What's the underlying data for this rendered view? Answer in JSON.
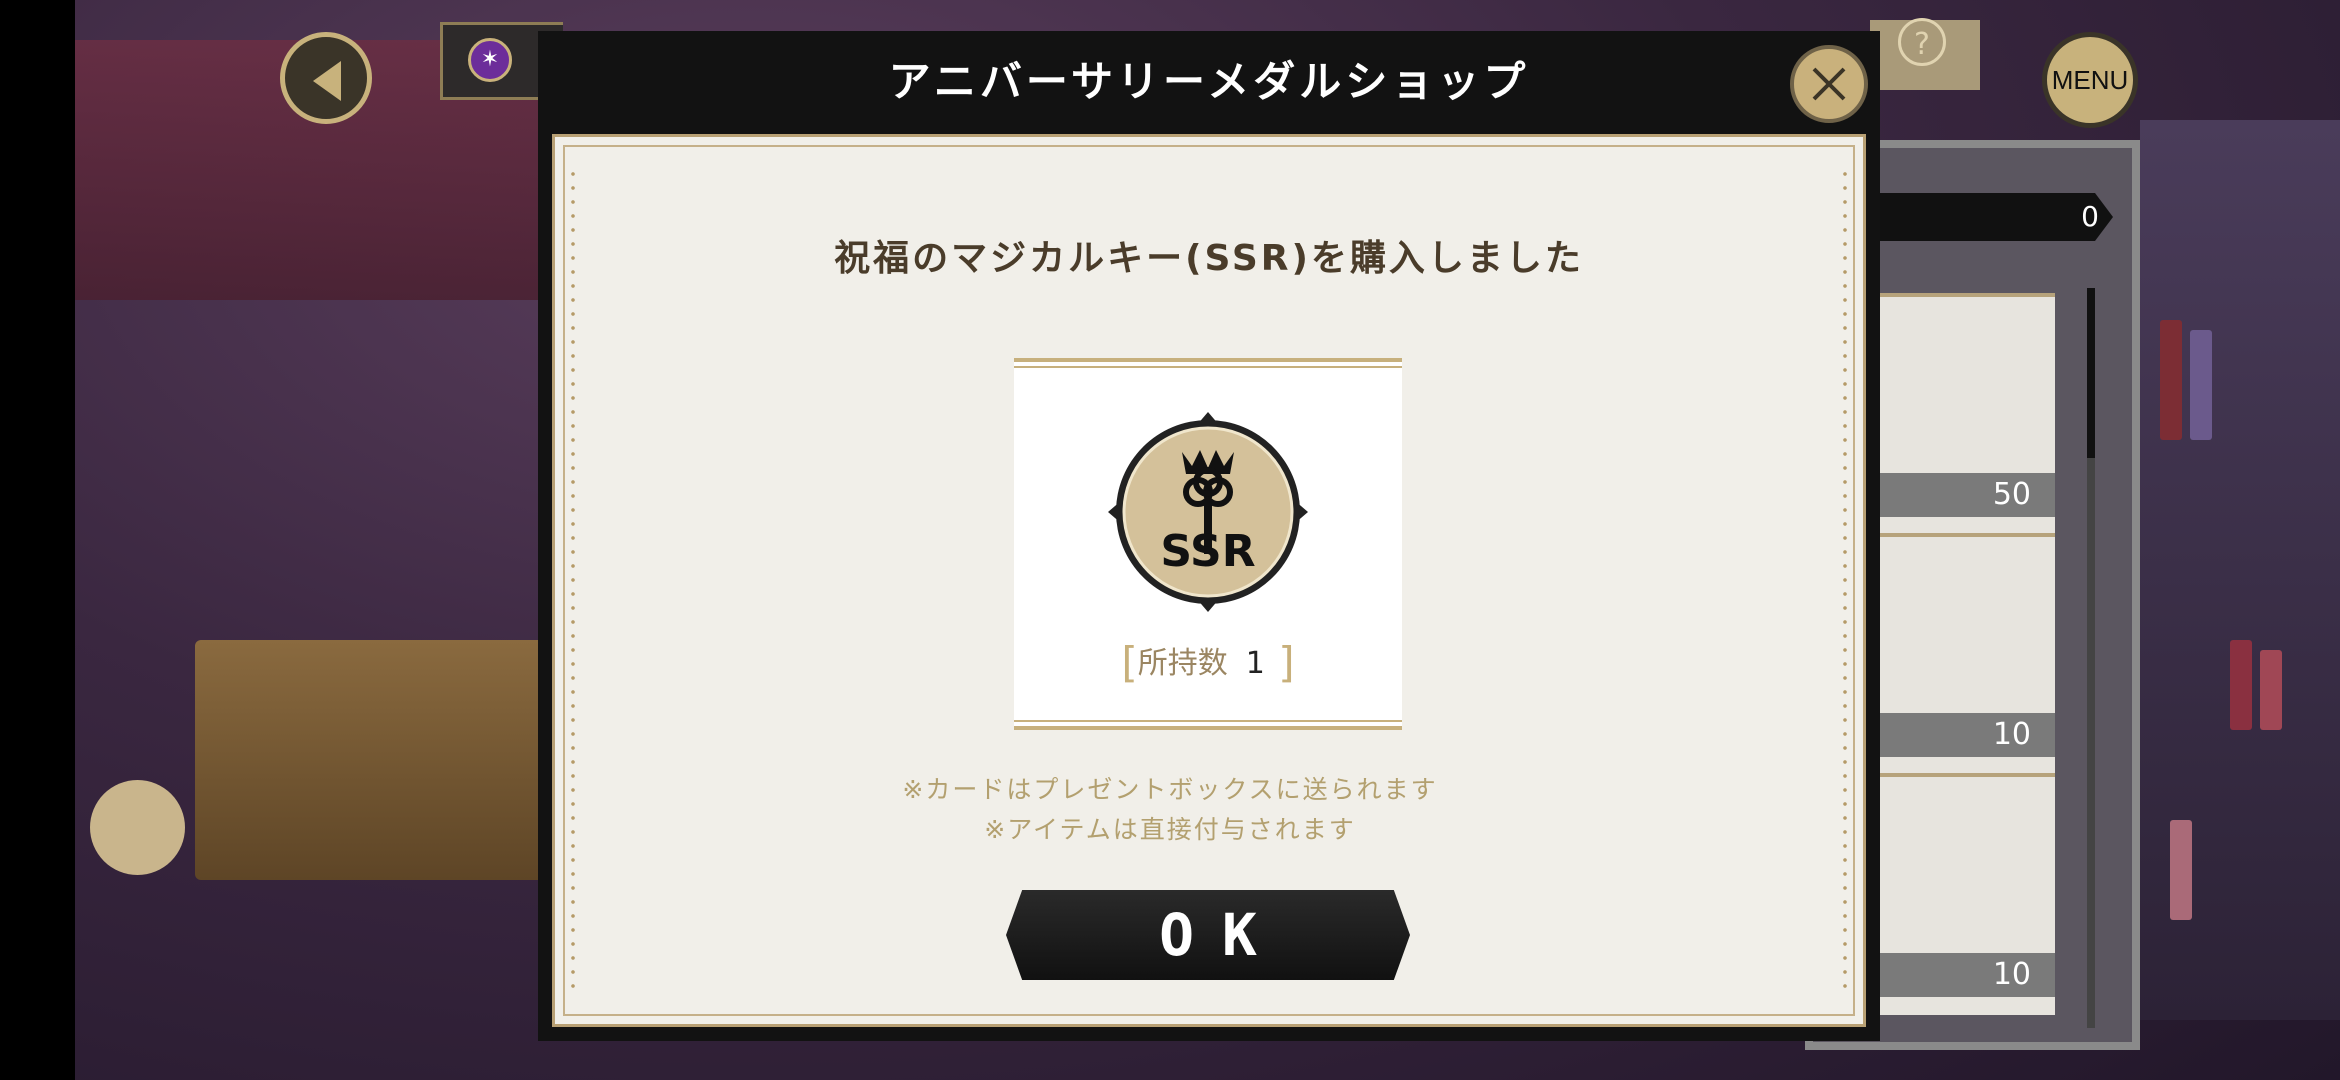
{
  "dialog": {
    "title": "アニバーサリーメダルショップ",
    "message": "祝福のマジカルキー(SSR)を購入しました",
    "item": {
      "icon": "ssr-magical-key-icon",
      "icon_text": "SSR",
      "owned_label": "所持数",
      "owned_count": "1"
    },
    "notes": [
      "※カードはプレゼントボックスに送られます",
      "※アイテムは直接付与されます"
    ],
    "ok_label": "OK",
    "close_icon": "close-icon"
  },
  "hud": {
    "menu_label": "MENU",
    "help_label": "?"
  },
  "shop_list": {
    "counter": "0",
    "prices": [
      "50",
      "10",
      "10"
    ]
  },
  "colors": {
    "gold": "#c9b17c",
    "dialog_frame": "#121212",
    "paper": "#f1efe9",
    "message_text": "#4a3c2a"
  }
}
